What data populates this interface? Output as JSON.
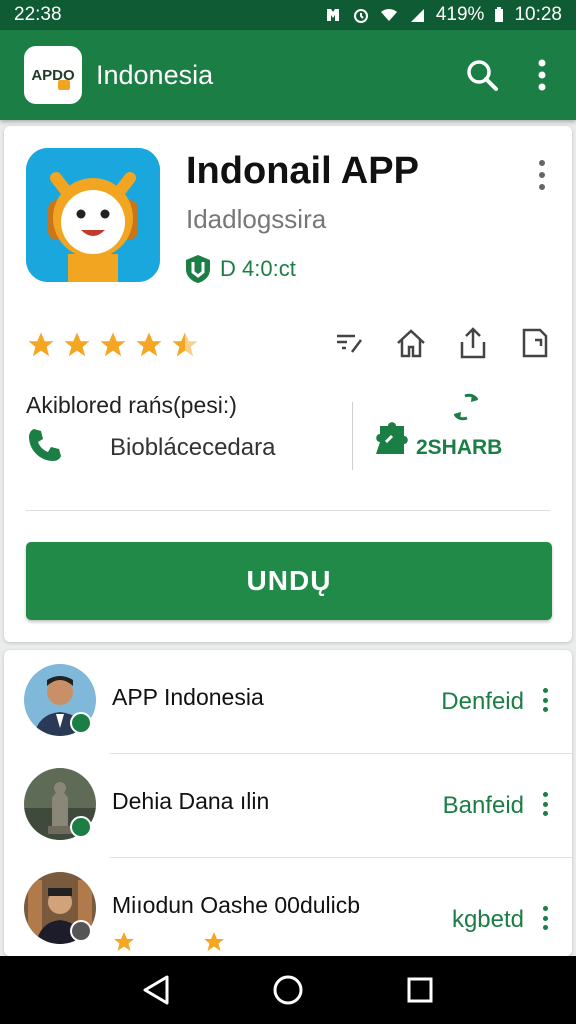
{
  "status_bar": {
    "time": "22:38",
    "battery": "419%",
    "clock": "10:28"
  },
  "app_bar": {
    "logo_text": "APDO",
    "title": "Indonesia",
    "icons": [
      "search-icon",
      "more-vert-icon"
    ]
  },
  "app_detail": {
    "name": "Indonail APP",
    "subtitle": "Idadlogssira",
    "verified_text": "D 4:0:ct",
    "rating_stars": 4.5,
    "action_icons": [
      "bookmark-icon",
      "home-icon",
      "share-icon",
      "export-icon"
    ],
    "contact_label": "Akiblored rańs(pesi:)",
    "contact_value": "Bioblácecedara",
    "share_count": "2SHARB",
    "install_label": "UNDŲ"
  },
  "list": {
    "items": [
      {
        "name": "APP Indonesia",
        "action": "Denfeid"
      },
      {
        "name": "Dehia Dana ılin",
        "action": "Banfeid"
      },
      {
        "name": "Miıodun Oashe 00dulicb",
        "action": "kgbetd"
      }
    ]
  },
  "colors": {
    "status_bar": "#0e5b34",
    "app_bar": "#1b7e45",
    "accent_green": "#218a48",
    "star": "#f5a623",
    "nav_bar": "#000000"
  }
}
